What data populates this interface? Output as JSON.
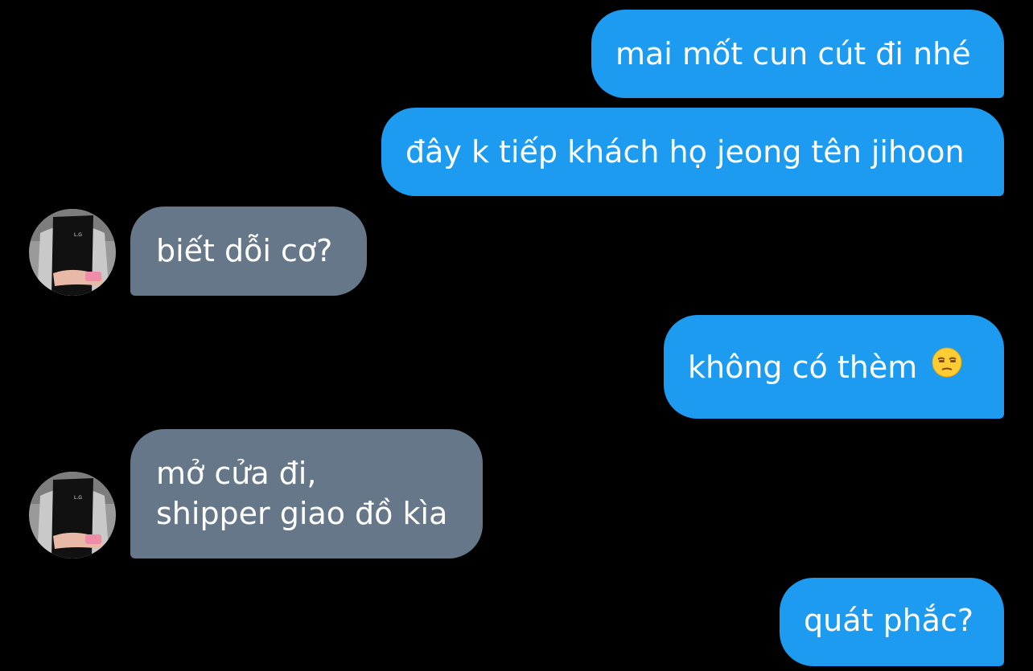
{
  "colors": {
    "background": "#000000",
    "sent_bubble": "#1d9bf0",
    "received_bubble": "#66778a",
    "text": "#ffffff"
  },
  "messages": [
    {
      "side": "sent",
      "text": "mai mốt cun cút đi nhé"
    },
    {
      "side": "sent",
      "text": "đây k tiếp khách họ jeong tên jihoon"
    },
    {
      "side": "received",
      "text": "biết dỗi cơ?",
      "avatar": "avatar-icon"
    },
    {
      "side": "sent",
      "text": "không có thèm",
      "emoji": "unamused-face-icon"
    },
    {
      "side": "received",
      "lines": [
        "mở cửa đi,",
        "shipper giao đồ kìa"
      ],
      "avatar": "avatar-icon"
    },
    {
      "side": "sent",
      "text": "quát phắc?"
    }
  ]
}
